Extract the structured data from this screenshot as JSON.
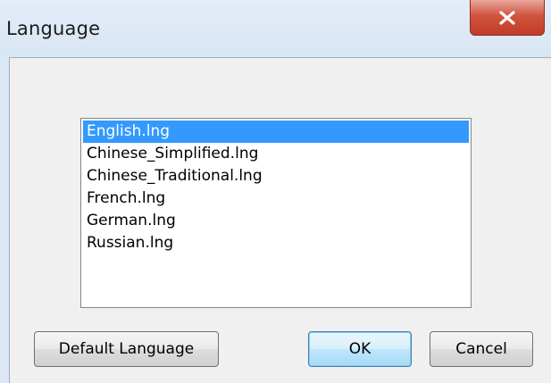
{
  "window": {
    "title": "Language"
  },
  "titlebar": {
    "close_icon": "close-icon"
  },
  "list": {
    "items": [
      {
        "label": "English.lng",
        "selected": true
      },
      {
        "label": "Chinese_Simplified.lng",
        "selected": false
      },
      {
        "label": "Chinese_Traditional.lng",
        "selected": false
      },
      {
        "label": "French.lng",
        "selected": false
      },
      {
        "label": "German.lng",
        "selected": false
      },
      {
        "label": "Russian.lng",
        "selected": false
      }
    ]
  },
  "buttons": {
    "default_language": "Default Language",
    "ok": "OK",
    "cancel": "Cancel"
  },
  "colors": {
    "selection": "#3399ff",
    "close_button": "#c94a35",
    "default_button_border": "#3c7fb1"
  }
}
